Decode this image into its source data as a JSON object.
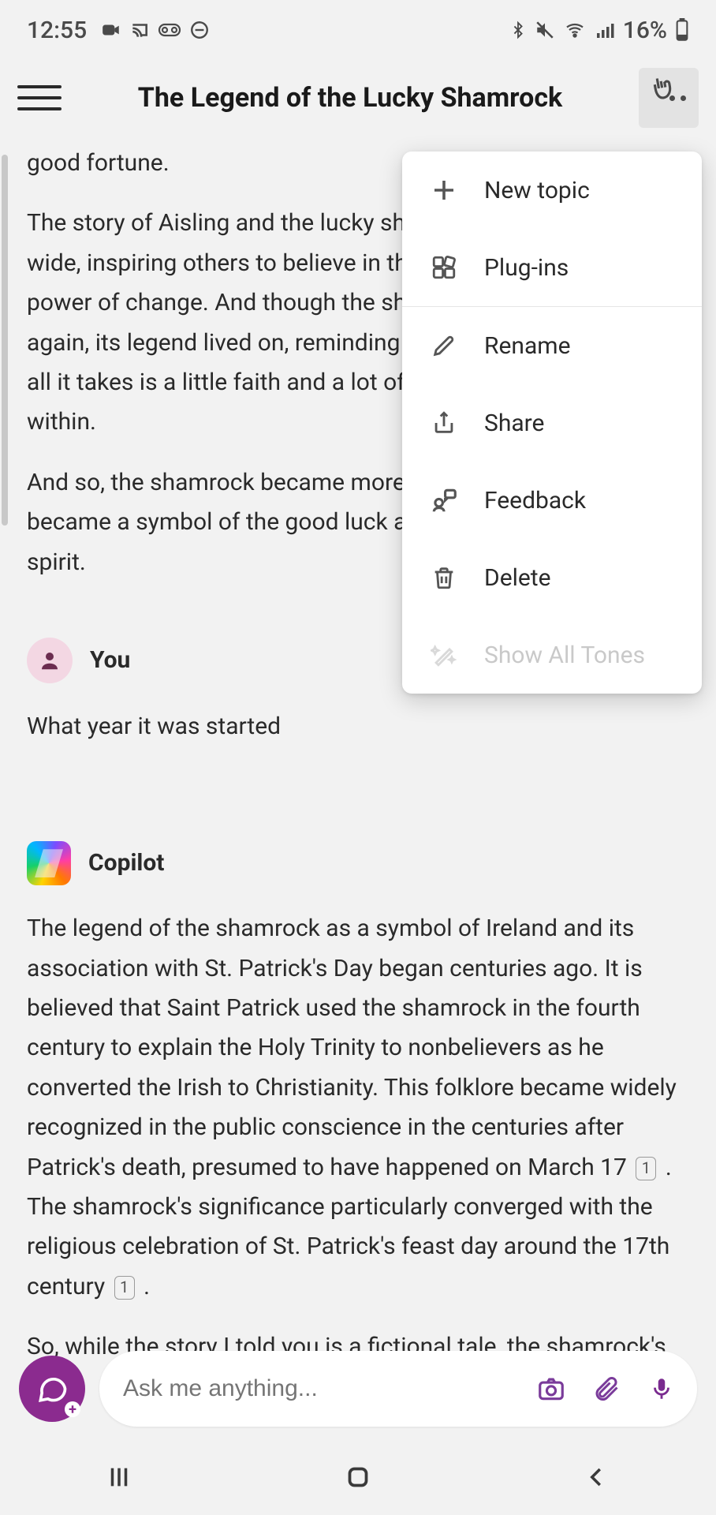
{
  "status_bar": {
    "time": "12:55",
    "battery_text": "16%"
  },
  "header": {
    "title": "The Legend of the Lucky Shamrock"
  },
  "chat": {
    "frag1": "good fortune.",
    "frag2": "The story of Aisling and the lucky shamrock spread far and wide, inspiring others to believe in the magic of hope and the power of change. And though the shamrock was never seen again, its legend lived on, reminding everyone that sometimes, all it takes is a little faith and a lot of heart to find the luck within.",
    "frag3": "And so, the shamrock became more than just a plant; it became a symbol of the good luck and resilience of the Irish spirit.",
    "user_label": "You",
    "user_msg": "What year it was started",
    "copilot_label": "Copilot",
    "copilot_p1a": "The legend of the shamrock as a symbol of Ireland and its association with St. Patrick's Day began centuries ago. It is believed that Saint Patrick used the shamrock in the fourth century to explain the Holy Trinity to nonbelievers as he converted the Irish to Christianity. This folklore became widely recognized in the public conscience in the centuries after Patrick's death, presumed to have happened on March 17",
    "cite1": "1",
    "copilot_p1b": ". The shamrock's significance particularly converged with the religious celebration of St. Patrick's feast day around the 17th century",
    "cite2": "1",
    "copilot_p1c": ".",
    "copilot_p2": "So, while the story I told you is a fictional tale, the shamrock's"
  },
  "menu": {
    "new_topic": "New topic",
    "plugins": "Plug-ins",
    "rename": "Rename",
    "share": "Share",
    "feedback": "Feedback",
    "delete": "Delete",
    "show_tones": "Show All Tones"
  },
  "input": {
    "placeholder": "Ask me anything..."
  }
}
